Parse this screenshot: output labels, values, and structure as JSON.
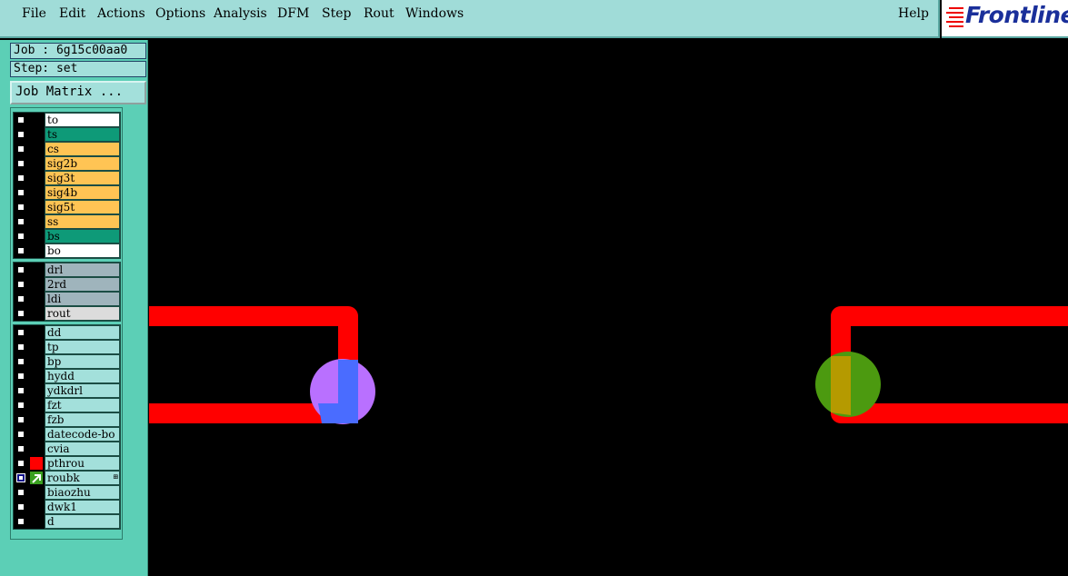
{
  "menubar": {
    "items": [
      "File",
      "Edit",
      "Actions",
      "Options",
      "Analysis",
      "DFM",
      "Step",
      "Rout",
      "Windows"
    ],
    "help": "Help"
  },
  "logo": {
    "text": "Frontline"
  },
  "job": {
    "label": "Job : 6g15c00aa0"
  },
  "step": {
    "label": "Step: set"
  },
  "job_matrix_button": "Job Matrix ...",
  "layers": {
    "board": [
      {
        "name": "to",
        "color": "#ffffff"
      },
      {
        "name": "ts",
        "color": "#0e9a78"
      },
      {
        "name": "cs",
        "color": "#ffc454"
      },
      {
        "name": "sig2b",
        "color": "#ffc454"
      },
      {
        "name": "sig3t",
        "color": "#ffc454"
      },
      {
        "name": "sig4b",
        "color": "#ffc454"
      },
      {
        "name": "sig5t",
        "color": "#ffc454"
      },
      {
        "name": "ss",
        "color": "#ffc454"
      },
      {
        "name": "bs",
        "color": "#0e9a78"
      },
      {
        "name": "bo",
        "color": "#ffffff"
      }
    ],
    "drill": [
      {
        "name": "drl",
        "color": "#9fb4bc"
      },
      {
        "name": "2rd",
        "color": "#9fb4bc"
      },
      {
        "name": "ldi",
        "color": "#9fb4bc"
      },
      {
        "name": "rout",
        "color": "#dcdcdc"
      }
    ],
    "misc": [
      {
        "name": "dd",
        "color": "#a3e0db"
      },
      {
        "name": "tp",
        "color": "#a3e0db"
      },
      {
        "name": "bp",
        "color": "#a3e0db"
      },
      {
        "name": "hydd",
        "color": "#a3e0db"
      },
      {
        "name": "ydkdrl",
        "color": "#a3e0db"
      },
      {
        "name": "fzt",
        "color": "#a3e0db"
      },
      {
        "name": "fzb",
        "color": "#a3e0db"
      },
      {
        "name": "datecode-bo",
        "color": "#a3e0db"
      },
      {
        "name": "cvia",
        "color": "#a3e0db"
      },
      {
        "name": "pthrou",
        "color": "#a3e0db",
        "swatch": "#ff0000"
      },
      {
        "name": "roubk",
        "color": "#a3e0db",
        "swatch": "#3aa020",
        "active": true
      },
      {
        "name": "biaozhu",
        "color": "#a3e0db"
      },
      {
        "name": "dwk1",
        "color": "#a3e0db"
      },
      {
        "name": "d",
        "color": "#a3e0db"
      }
    ]
  },
  "colors": {
    "trace": "#ff0000",
    "pad_left": "#b970ff",
    "pad_left_overlap": "#4a6cff",
    "pad_right": "#4c9a10",
    "pad_right_overlap": "#b59a00"
  }
}
